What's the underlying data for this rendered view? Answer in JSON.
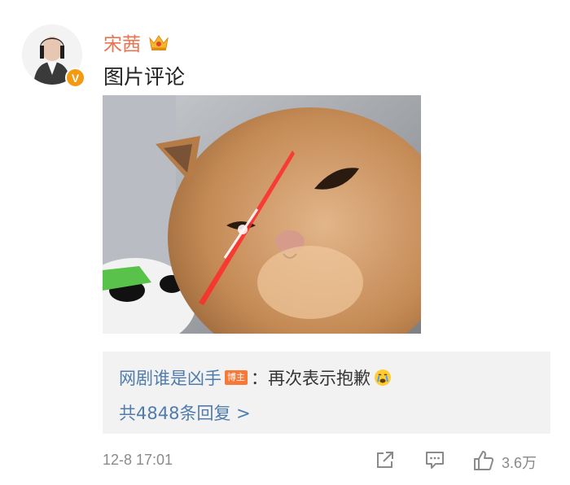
{
  "user": {
    "name": "宋茜",
    "verified_badge": "V"
  },
  "comment": {
    "text": "图片评论"
  },
  "reply": {
    "username": "网剧谁是凶手",
    "badge": "博主",
    "separator": "：",
    "text": "再次表示抱歉",
    "emoji": "crying-face-icon",
    "count_text": "共4848条回复 >"
  },
  "meta": {
    "timestamp": "12-8 17:01",
    "like_count": "3.6万"
  },
  "colors": {
    "accent": "#eb7350",
    "link": "#4f7cad",
    "badge": "#f57a3a",
    "vbadge": "#f49a10"
  }
}
